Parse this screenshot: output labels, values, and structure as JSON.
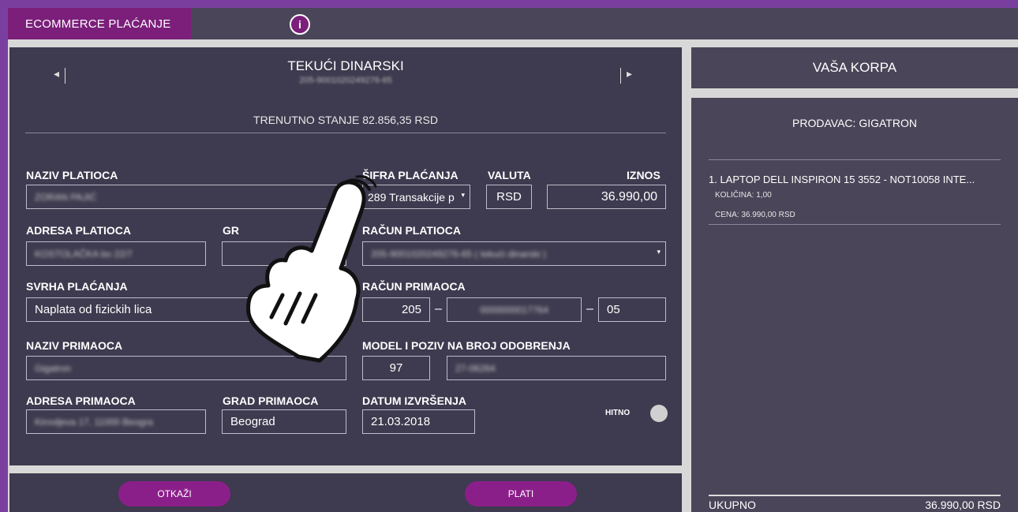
{
  "header": {
    "title": "ECOMMERCE PLAĆANJE",
    "info_label": "i"
  },
  "account": {
    "prev": "◂",
    "next": "▸",
    "name": "TEKUĆI DINARSKI",
    "number": "205-9001020249276-65",
    "balance": "TRENUTNO STANJE 82.856,35 RSD"
  },
  "form": {
    "payer_name_label": "NAZIV PLATIOCA",
    "payer_name_value": "ZORAN PAJIĆ",
    "code_label": "ŠIFRA PLAĆANJA",
    "code_value": "289 Transakcije p",
    "currency_label": "VALUTA",
    "currency_value": "RSD",
    "amount_label": "IZNOS",
    "amount_value": "36.990,00",
    "payer_address_label": "ADRESA PLATIOCA",
    "payer_address_value": "KOSTOLAČKA bo 22/7",
    "payer_city_label": "GR",
    "payer_city_value": "",
    "payer_account_label": "RAČUN PLATIOCA",
    "payer_account_value": "205-9001020249276-65 ( tekući dinarski )",
    "purpose_label": "SVRHA PLAĆANJA",
    "purpose_value": "Naplata od fizickih lica",
    "recipient_account_label": "RAČUN PRIMAOCA",
    "recipient_bank": "205",
    "recipient_account_mid": "0000000017764",
    "recipient_control": "05",
    "dash": "–",
    "recipient_name_label": "NAZIV PRIMAOCA",
    "recipient_name_value": "Gigatron",
    "model_label": "MODEL I POZIV NA BROJ ODOBRENJA",
    "model_value": "97",
    "reference_value": "27-06264",
    "recipient_address_label": "ADRESA PRIMAOCA",
    "recipient_address_value": "Kirovljeva 17, 11000 Beogra",
    "recipient_city_label": "GRAD PRIMAOCA",
    "recipient_city_value": "Beograd",
    "date_label": "DATUM IZVRŠENJA",
    "date_value": "21.03.2018",
    "urgent_label": "HITNO"
  },
  "buttons": {
    "cancel": "OTKAŽI",
    "pay": "PLATI"
  },
  "cart": {
    "title": "VAŠA KORPA",
    "seller": "PRODAVAC: GIGATRON",
    "item": "1. LAPTOP DELL INSPIRON 15 3552 - NOT10058 INTE...",
    "quantity": "KOLIČINA: 1,00",
    "price": "CENA: 36.990,00 RSD",
    "total_label": "UKUPNO",
    "total_value": "36.990,00 RSD"
  },
  "colors": {
    "accent": "#7b1f7a",
    "panel": "#3e3a4f",
    "panel_light": "#4a4558"
  },
  "icons": {
    "hand": "pointing-hand-icon",
    "info": "info-icon"
  }
}
